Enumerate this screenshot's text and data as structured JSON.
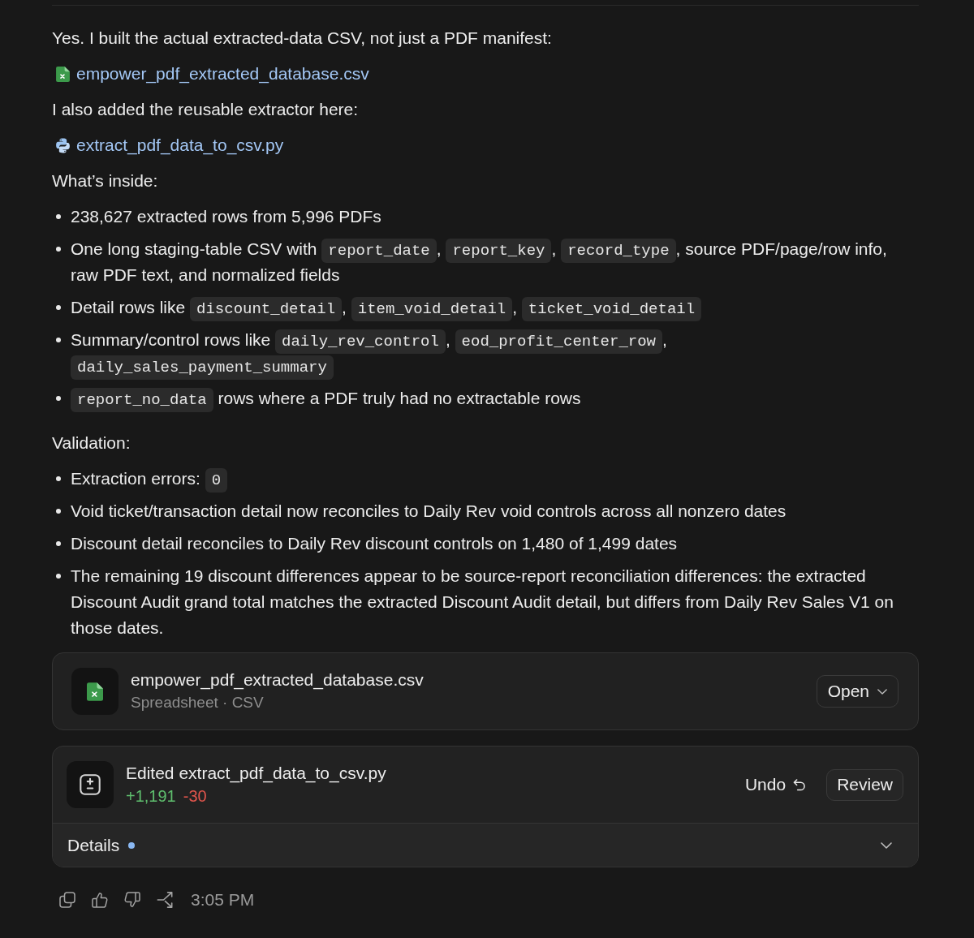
{
  "message": {
    "blocks": [
      {
        "kind": "paragraph",
        "text": "Yes. I built the actual extracted-data CSV, not just a PDF manifest:"
      },
      {
        "kind": "file_link",
        "link": {
          "kind": "spreadsheet",
          "text": "empower_pdf_extracted_database.csv"
        }
      },
      {
        "kind": "paragraph",
        "text": "I also added the reusable extractor here:"
      },
      {
        "kind": "file_link",
        "link": {
          "kind": "python",
          "text": "extract_pdf_data_to_csv.py"
        }
      },
      {
        "kind": "paragraph",
        "text": "What’s inside:"
      },
      {
        "kind": "list",
        "items": [
          {
            "segments": [
              {
                "kind": "text",
                "text": "238,627 extracted rows from 5,996 PDFs"
              }
            ]
          },
          {
            "segments": [
              {
                "kind": "text",
                "text": "One long staging-table CSV with "
              },
              {
                "kind": "code",
                "text": "report_date"
              },
              {
                "kind": "text",
                "text": ", "
              },
              {
                "kind": "code",
                "text": "report_key"
              },
              {
                "kind": "text",
                "text": ", "
              },
              {
                "kind": "code",
                "text": "record_type"
              },
              {
                "kind": "text",
                "text": ", source PDF/page/row info, raw PDF text, and normalized fields"
              }
            ]
          },
          {
            "segments": [
              {
                "kind": "text",
                "text": "Detail rows like "
              },
              {
                "kind": "code",
                "text": "discount_detail"
              },
              {
                "kind": "text",
                "text": ", "
              },
              {
                "kind": "code",
                "text": "item_void_detail"
              },
              {
                "kind": "text",
                "text": ", "
              },
              {
                "kind": "code",
                "text": "ticket_void_detail"
              }
            ]
          },
          {
            "segments": [
              {
                "kind": "text",
                "text": "Summary/control rows like "
              },
              {
                "kind": "code",
                "text": "daily_rev_control"
              },
              {
                "kind": "text",
                "text": ", "
              },
              {
                "kind": "code",
                "text": "eod_profit_center_row"
              },
              {
                "kind": "text",
                "text": ", "
              },
              {
                "kind": "code",
                "text": "daily_sales_payment_summary"
              }
            ]
          },
          {
            "segments": [
              {
                "kind": "code",
                "text": "report_no_data"
              },
              {
                "kind": "text",
                "text": " rows where a PDF truly had no extractable rows"
              }
            ]
          }
        ]
      },
      {
        "kind": "paragraph",
        "text": "Validation:"
      },
      {
        "kind": "list",
        "items": [
          {
            "segments": [
              {
                "kind": "text",
                "text": "Extraction errors: "
              },
              {
                "kind": "code",
                "text": "0"
              }
            ]
          },
          {
            "segments": [
              {
                "kind": "text",
                "text": "Void ticket/transaction detail now reconciles to Daily Rev void controls across all nonzero dates"
              }
            ]
          },
          {
            "segments": [
              {
                "kind": "text",
                "text": "Discount detail reconciles to Daily Rev discount controls on 1,480 of 1,499 dates"
              }
            ]
          },
          {
            "segments": [
              {
                "kind": "text",
                "text": "The remaining 19 discount differences appear to be source-report reconciliation differences: the extracted Discount Audit grand total matches the extracted Discount Audit detail, but differs from Daily Rev Sales V1 on those dates."
              }
            ]
          }
        ]
      }
    ]
  },
  "file_card": {
    "kind": "spreadsheet",
    "name": "empower_pdf_extracted_database.csv",
    "subtitle": "Spreadsheet · CSV",
    "button": "Open"
  },
  "edit_card": {
    "title": "Edited extract_pdf_data_to_csv.py",
    "added": "+1,191",
    "removed": "-30",
    "undo": "Undo",
    "review": "Review",
    "details": {
      "label": "Details",
      "unread": true,
      "expanded": false
    }
  },
  "footer": {
    "time": "3:05 PM"
  }
}
